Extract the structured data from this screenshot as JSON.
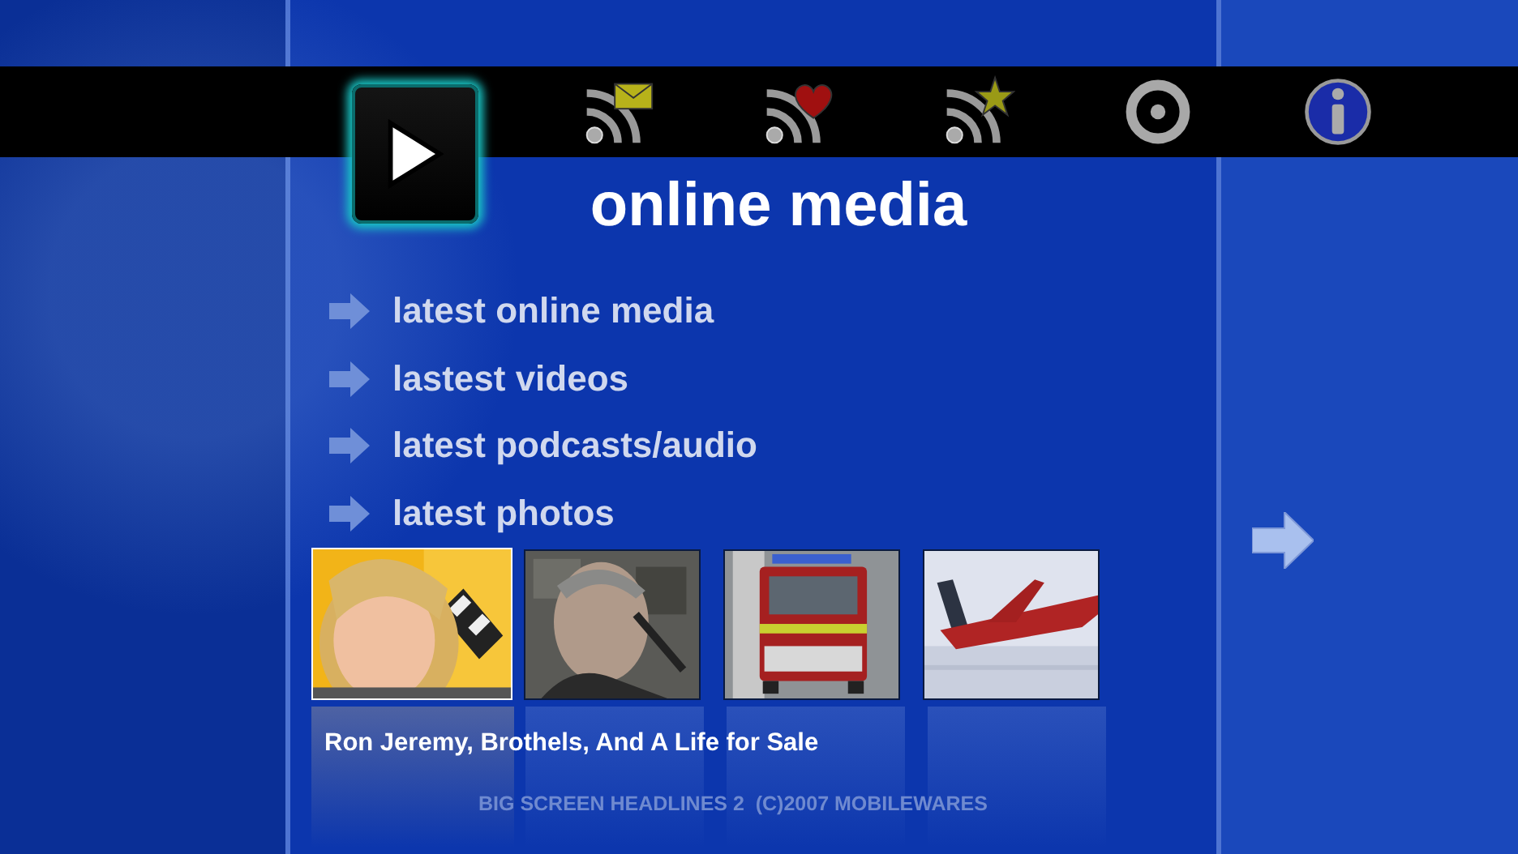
{
  "toolbar": [
    {
      "kind": "play",
      "selected": true
    },
    {
      "kind": "rss-mail",
      "selected": false
    },
    {
      "kind": "rss-heart",
      "selected": false
    },
    {
      "kind": "rss-star",
      "selected": false
    },
    {
      "kind": "target",
      "selected": false
    },
    {
      "kind": "info",
      "selected": false
    }
  ],
  "title": "online media",
  "menu": [
    "latest online media",
    "lastest videos",
    "latest podcasts/audio",
    "latest photos"
  ],
  "thumbnails": [
    {
      "kind": "picture",
      "selected": true
    },
    {
      "kind": "picture",
      "selected": false
    },
    {
      "kind": "picture",
      "selected": false
    },
    {
      "kind": "picture",
      "selected": false
    }
  ],
  "caption": "Ron Jeremy, Brothels, And A Life for Sale",
  "footer": "BIG SCREEN HEADLINES 2  (C)2007 MOBILEWARES"
}
